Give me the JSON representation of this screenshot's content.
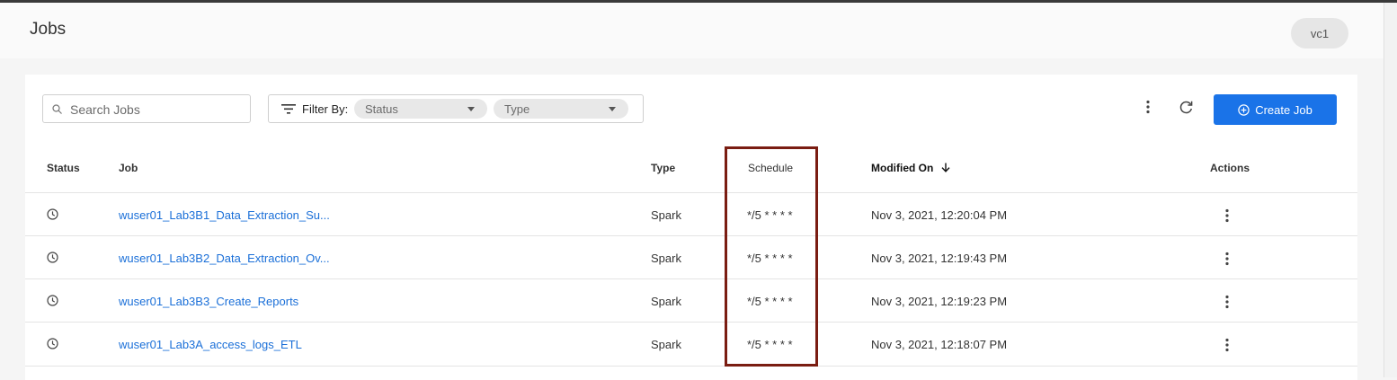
{
  "header": {
    "title": "Jobs",
    "vc_label": "vc1"
  },
  "toolbar": {
    "search_placeholder": "Search Jobs",
    "filter_label": "Filter By:",
    "filter_status": "Status",
    "filter_type": "Type",
    "create_label": "Create Job"
  },
  "table": {
    "columns": {
      "status": "Status",
      "job": "Job",
      "type": "Type",
      "schedule": "Schedule",
      "modified": "Modified On",
      "actions": "Actions"
    },
    "rows": [
      {
        "job": "wuser01_Lab3B1_Data_Extraction_Su...",
        "type": "Spark",
        "schedule": "*/5 * * * *",
        "modified": "Nov 3, 2021, 12:20:04 PM"
      },
      {
        "job": "wuser01_Lab3B2_Data_Extraction_Ov...",
        "type": "Spark",
        "schedule": "*/5 * * * *",
        "modified": "Nov 3, 2021, 12:19:43 PM"
      },
      {
        "job": "wuser01_Lab3B3_Create_Reports",
        "type": "Spark",
        "schedule": "*/5 * * * *",
        "modified": "Nov 3, 2021, 12:19:23 PM"
      },
      {
        "job": "wuser01_Lab3A_access_logs_ETL",
        "type": "Spark",
        "schedule": "*/5 * * * *",
        "modified": "Nov 3, 2021, 12:18:07 PM"
      }
    ]
  },
  "colors": {
    "accent": "#1a73e8",
    "link": "#1a6fd8",
    "highlight": "#7a1d12"
  },
  "icons": [
    "search-icon",
    "filter-icon",
    "kebab-icon",
    "refresh-icon",
    "add-circle-icon",
    "clock-icon",
    "sort-down-arrow-icon"
  ]
}
